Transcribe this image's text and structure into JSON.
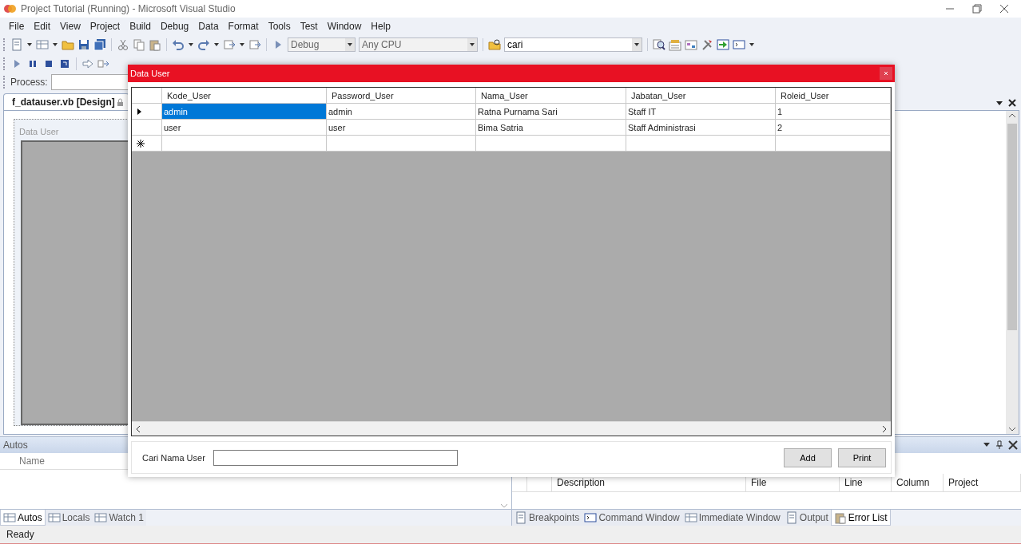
{
  "window": {
    "title": "Project Tutorial (Running) - Microsoft Visual Studio"
  },
  "menu": [
    "File",
    "Edit",
    "View",
    "Project",
    "Build",
    "Debug",
    "Data",
    "Format",
    "Tools",
    "Test",
    "Window",
    "Help"
  ],
  "toolbar": {
    "configuration": "Debug",
    "platform": "Any CPU",
    "find": "cari"
  },
  "process": {
    "label": "Process:"
  },
  "document_tab": {
    "label": "f_datauser.vb [Design]",
    "selected": true
  },
  "designer_form": {
    "title": "Data User"
  },
  "autos": {
    "title": "Autos",
    "columns": [
      "Name"
    ]
  },
  "error_list": {
    "columns": [
      "Description",
      "File",
      "Line",
      "Column",
      "Project"
    ]
  },
  "left_tabs": [
    {
      "label": "Autos",
      "selected": true
    },
    {
      "label": "Locals",
      "selected": false
    },
    {
      "label": "Watch 1",
      "selected": false
    }
  ],
  "right_tabs": [
    {
      "label": "Breakpoints",
      "selected": false
    },
    {
      "label": "Command Window",
      "selected": false
    },
    {
      "label": "Immediate Window",
      "selected": false
    },
    {
      "label": "Output",
      "selected": false
    },
    {
      "label": "Error List",
      "selected": true
    }
  ],
  "status_bar": "Ready",
  "dialog": {
    "title": "Data User",
    "grid": {
      "columns": [
        "Kode_User",
        "Password_User",
        "Nama_User",
        "Jabatan_User",
        "Roleid_User"
      ],
      "rows": [
        {
          "current": true,
          "cells": [
            {
              "text": "admin",
              "selected": true
            },
            {
              "text": "admin",
              "selected": false
            },
            {
              "text": "Ratna Purnama Sari",
              "selected": false
            },
            {
              "text": "Staff IT",
              "selected": false
            },
            {
              "text": "1",
              "selected": false
            }
          ]
        },
        {
          "current": false,
          "cells": [
            {
              "text": "user",
              "selected": false
            },
            {
              "text": "user",
              "selected": false
            },
            {
              "text": "Bima Satria",
              "selected": false
            },
            {
              "text": "Staff Administrasi",
              "selected": false
            },
            {
              "text": "2",
              "selected": false
            }
          ]
        }
      ],
      "new_row": true
    },
    "search_label": "Cari Nama User",
    "buttons": [
      "Add",
      "Print"
    ]
  }
}
